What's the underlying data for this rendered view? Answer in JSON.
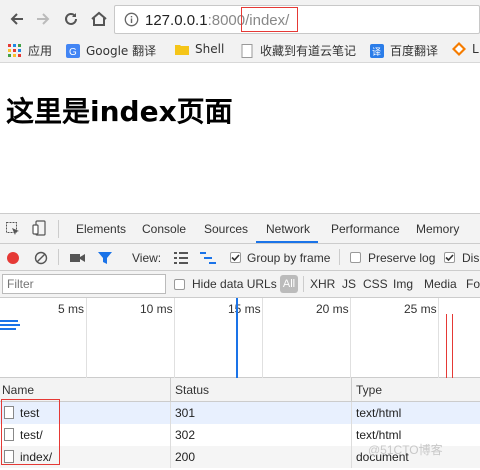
{
  "browser": {
    "url_host": "127.0.0.1",
    "url_port": ":8000",
    "url_path": "/index/",
    "info_icon": "info-circle-icon"
  },
  "bookmarks": [
    {
      "label": "应用",
      "icon": "apps-grid-icon"
    },
    {
      "label": "Google 翻译",
      "icon": "google-translate-icon"
    },
    {
      "label": "Shell",
      "icon": "folder-icon"
    },
    {
      "label": "收藏到有道云笔记",
      "icon": "page-icon"
    },
    {
      "label": "百度翻译",
      "icon": "baidu-translate-icon"
    },
    {
      "label": "L",
      "icon": "diamond-icon"
    }
  ],
  "page": {
    "heading": "这里是index页面"
  },
  "devtools": {
    "tabs": [
      "Elements",
      "Console",
      "Sources",
      "Network",
      "Performance",
      "Memory"
    ],
    "active_tab": "Network",
    "view_label": "View:",
    "group_by_frame": "Group by frame",
    "preserve_log": "Preserve log",
    "disable_cache": "Dis",
    "filter_placeholder": "Filter",
    "hide_data_urls": "Hide data URLs",
    "all_label": "All",
    "type_filters": [
      "XHR",
      "JS",
      "CSS",
      "Img",
      "Media",
      "Fo"
    ],
    "timeline_labels": [
      "5 ms",
      "10 ms",
      "15 ms",
      "20 ms",
      "25 ms"
    ],
    "columns": [
      "Name",
      "Status",
      "Type"
    ],
    "requests": [
      {
        "name": "test",
        "status": "301",
        "type": "text/html"
      },
      {
        "name": "test/",
        "status": "302",
        "type": "text/html"
      },
      {
        "name": "index/",
        "status": "200",
        "type": "document"
      }
    ]
  },
  "watermark": "@51CTO博客",
  "colors": {
    "highlight": "#e53935",
    "record": "#e53935",
    "accent": "#1a73e8"
  }
}
